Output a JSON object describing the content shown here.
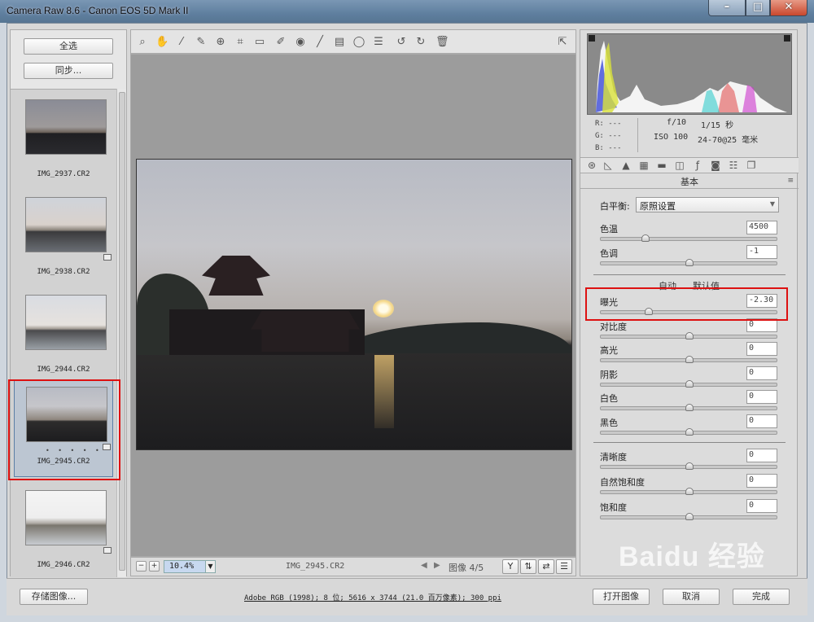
{
  "window": {
    "title": "Camera Raw 8.6 -  Canon EOS 5D Mark II"
  },
  "filmstrip": {
    "select_all": "全选",
    "synchronize": "同步...",
    "thumbnails": [
      {
        "name": "IMG_2937.CR2",
        "rating": "",
        "selected": false
      },
      {
        "name": "IMG_2938.CR2",
        "rating": "",
        "selected": false
      },
      {
        "name": "IMG_2944.CR2",
        "rating": "",
        "selected": false
      },
      {
        "name": "IMG_2945.CR2",
        "rating": "• • • • •",
        "selected": true
      },
      {
        "name": "IMG_2946.CR2",
        "rating": "",
        "selected": false
      }
    ]
  },
  "toolbar": {
    "tools": [
      "zoom-icon",
      "hand-icon",
      "white-balance-icon",
      "color-sampler-icon",
      "targeted-adjust-icon",
      "crop-icon",
      "straighten-icon",
      "spot-removal-icon",
      "red-eye-icon",
      "adjustment-brush-icon",
      "graduated-filter-icon",
      "radial-filter-icon",
      "list-icon",
      "rotate-ccw-icon",
      "rotate-cw-icon",
      "trash-icon"
    ],
    "open_prefs": "export-icon"
  },
  "preview": {
    "zoom": "10.4%",
    "filename": "IMG_2945.CR2",
    "image_counter": "图像 4/5"
  },
  "histogram": {
    "r_label": "R:",
    "g_label": "G:",
    "b_label": "B:",
    "r_value": "---",
    "g_value": "---",
    "b_value": "---",
    "aperture": "f/10",
    "shutter": "1/15 秒",
    "iso": "ISO 100",
    "lens": "24-70@25 毫米"
  },
  "panel": {
    "section_title": "基本",
    "white_balance_label": "白平衡:",
    "white_balance_value": "原照设置",
    "auto_label": "自动",
    "default_label": "默认值",
    "sliders_top": [
      {
        "label": "色温",
        "value": "4500",
        "pos": 0.25
      },
      {
        "label": "色调",
        "value": "-1",
        "pos": 0.5
      }
    ],
    "sliders_mid": [
      {
        "label": "曝光",
        "value": "-2.30",
        "pos": 0.27
      },
      {
        "label": "对比度",
        "value": "0",
        "pos": 0.5
      },
      {
        "label": "高光",
        "value": "0",
        "pos": 0.5
      },
      {
        "label": "阴影",
        "value": "0",
        "pos": 0.5
      },
      {
        "label": "白色",
        "value": "0",
        "pos": 0.5
      },
      {
        "label": "黑色",
        "value": "0",
        "pos": 0.5
      }
    ],
    "sliders_bottom": [
      {
        "label": "清晰度",
        "value": "0",
        "pos": 0.5
      },
      {
        "label": "自然饱和度",
        "value": "0",
        "pos": 0.5
      },
      {
        "label": "饱和度",
        "value": "0",
        "pos": 0.5
      }
    ]
  },
  "bottom": {
    "save_label": "存储图像...",
    "info_link": "Adobe RGB (1998); 8 位; 5616 x 3744 (21.0 百万像素); 300 ppi",
    "open_label": "打开图像",
    "cancel_label": "取消",
    "done_label": "完成"
  },
  "watermark": "Baidu 经验"
}
